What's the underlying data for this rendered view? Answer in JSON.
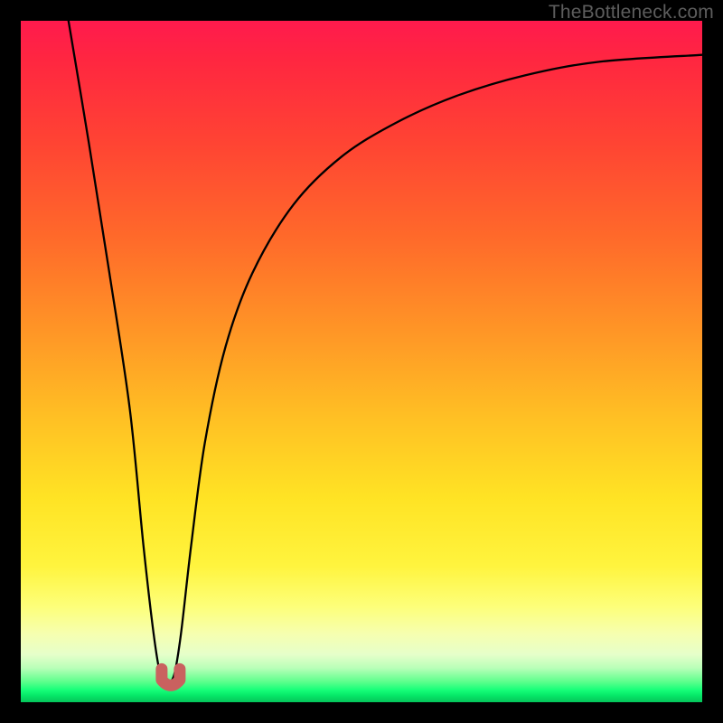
{
  "watermark": "TheBottleneck.com",
  "chart_data": {
    "type": "line",
    "title": "",
    "xlabel": "",
    "ylabel": "",
    "xlim": [
      0,
      100
    ],
    "ylim": [
      0,
      100
    ],
    "grid": false,
    "legend": false,
    "series": [
      {
        "name": "bottleneck-curve",
        "x": [
          7,
          10,
          13,
          16,
          18,
          19.5,
          20.5,
          21.5,
          22.5,
          23.5,
          25,
          27,
          30,
          34,
          40,
          47,
          55,
          64,
          74,
          85,
          100
        ],
        "y": [
          100,
          82,
          63,
          43,
          23,
          10,
          4,
          3,
          4,
          10,
          23,
          38,
          52,
          63,
          73,
          80,
          85,
          89,
          92,
          94,
          95
        ]
      }
    ],
    "marker": {
      "name": "optimal-point",
      "x": 22,
      "y": 3,
      "color": "#c9615f"
    },
    "gradient_colors": {
      "top": "#ff1a4d",
      "mid_upper": "#ff9726",
      "mid": "#ffe324",
      "mid_lower": "#fdff7a",
      "bottom": "#05c55a"
    }
  }
}
